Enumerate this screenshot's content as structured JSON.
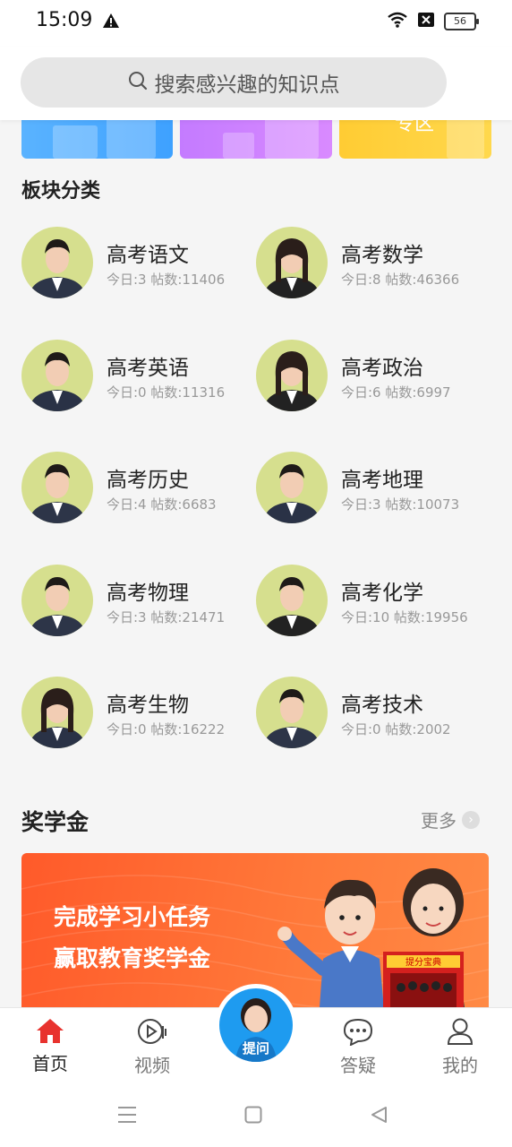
{
  "status_bar": {
    "time": "15:09",
    "battery": "56"
  },
  "search": {
    "placeholder": "搜索感兴趣的知识点"
  },
  "banner_tiles": [
    {
      "color": "#4aaaff",
      "label": ""
    },
    {
      "color": "#cf84ff",
      "label": ""
    },
    {
      "color": "#ffd23f",
      "label": "专区"
    }
  ],
  "categories": {
    "title": "板块分类",
    "items": [
      {
        "name": "高考语文",
        "stats": "今日:3 帖数:11406"
      },
      {
        "name": "高考数学",
        "stats": "今日:8 帖数:46366"
      },
      {
        "name": "高考英语",
        "stats": "今日:0 帖数:11316"
      },
      {
        "name": "高考政治",
        "stats": "今日:6 帖数:6997"
      },
      {
        "name": "高考历史",
        "stats": "今日:4 帖数:6683"
      },
      {
        "name": "高考地理",
        "stats": "今日:3 帖数:10073"
      },
      {
        "name": "高考物理",
        "stats": "今日:3 帖数:21471"
      },
      {
        "name": "高考化学",
        "stats": "今日:10 帖数:19956"
      },
      {
        "name": "高考生物",
        "stats": "今日:0 帖数:16222"
      },
      {
        "name": "高考技术",
        "stats": "今日:0 帖数:2002"
      }
    ]
  },
  "scholarship": {
    "title": "奖学金",
    "more": "更多",
    "banner_line1": "完成学习小任务",
    "banner_line2": "赢取教育奖学金",
    "badge_text": "提分宝典"
  },
  "tabbar": {
    "home": "首页",
    "video": "视频",
    "ask": "提问",
    "qa": "答疑",
    "mine": "我的"
  },
  "colors": {
    "accent_red": "#e8322e",
    "fab_blue": "#1e9bf0",
    "avatar_bg": "#d6df8e"
  }
}
